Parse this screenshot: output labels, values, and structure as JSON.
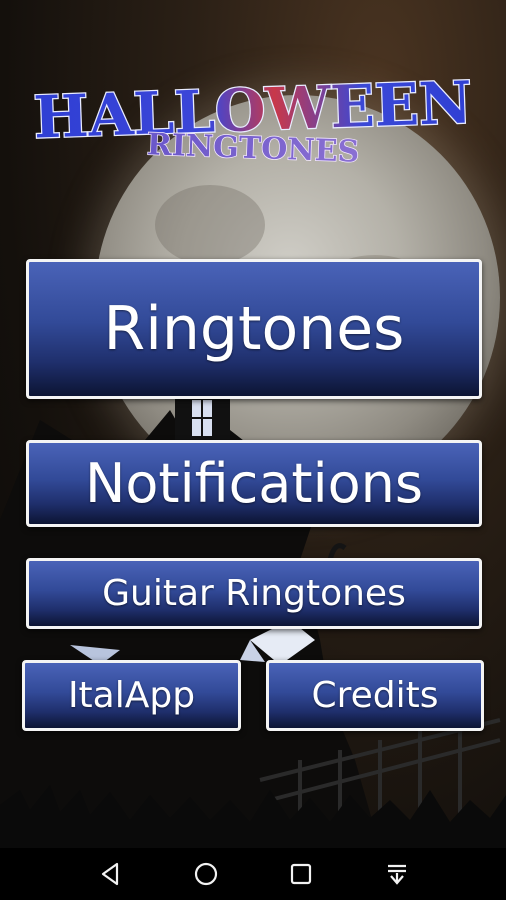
{
  "logo": {
    "line1": "HALLOWEEN",
    "line2": "RINGTONES"
  },
  "buttons": {
    "ringtones": "Ringtones",
    "notifications": "Notifications",
    "guitar": "Guitar Ringtones",
    "italapp": "ItalApp",
    "credits": "Credits"
  },
  "navbar": {
    "back": "back-icon",
    "home": "home-icon",
    "recent": "recent-apps-icon",
    "menu": "menu-down-icon"
  },
  "colors": {
    "button_top": "#4a63b8",
    "button_bottom": "#0c1433",
    "logo_blue": "#2f3fd4",
    "logo_red": "#c8384a"
  }
}
